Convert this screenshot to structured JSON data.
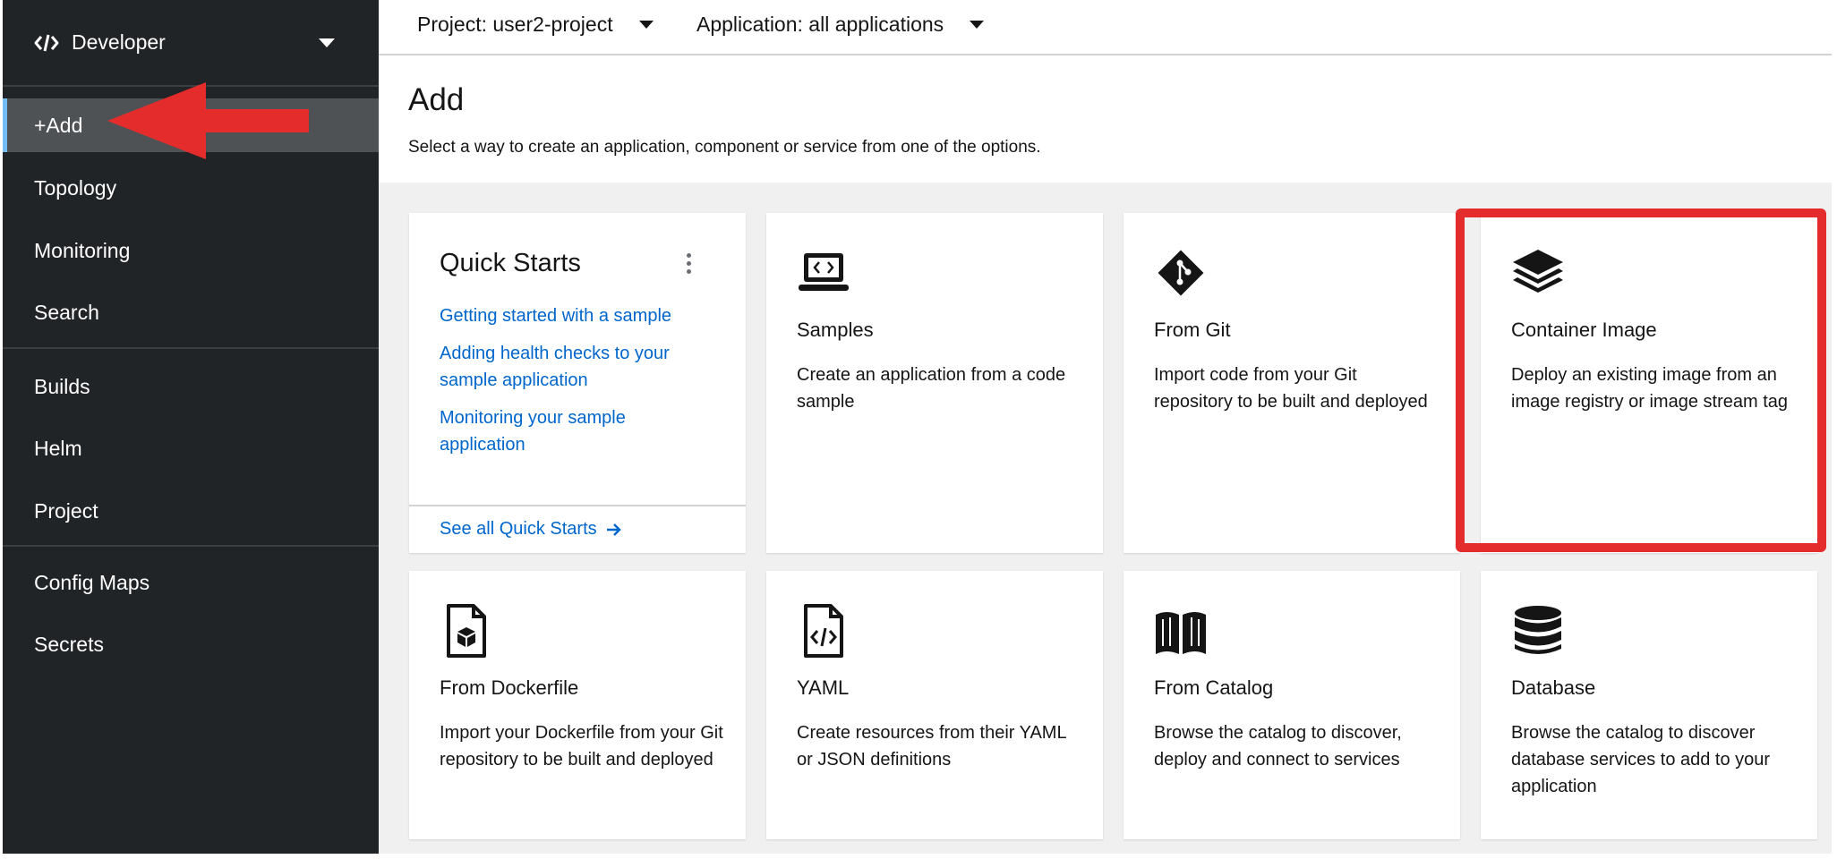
{
  "sidebar": {
    "perspective": "Developer",
    "items": [
      {
        "label": "+Add"
      },
      {
        "label": "Topology"
      },
      {
        "label": "Monitoring"
      },
      {
        "label": "Search"
      },
      {
        "label": "Builds"
      },
      {
        "label": "Helm"
      },
      {
        "label": "Project"
      },
      {
        "label": "Config Maps"
      },
      {
        "label": "Secrets"
      }
    ]
  },
  "topbar": {
    "project": "Project: user2-project",
    "application": "Application: all applications"
  },
  "page": {
    "title": "Add",
    "description": "Select a way to create an application, component or service from one of the options."
  },
  "quick_starts": {
    "title": "Quick Starts",
    "links": [
      "Getting started with a sample",
      "Adding health checks to your sample application",
      "Monitoring your sample application"
    ],
    "see_all": "See all Quick Starts"
  },
  "cards": [
    {
      "title": "Samples",
      "description": "Create an application from a code sample",
      "icon": "laptop-code-icon"
    },
    {
      "title": "From Git",
      "description": "Import code from your Git repository to be built and deployed",
      "icon": "git-icon"
    },
    {
      "title": "Container Image",
      "description": "Deploy an existing image from an image registry or image stream tag",
      "icon": "layer-group-icon"
    },
    {
      "title": "From Dockerfile",
      "description": "Import your Dockerfile from your Git repository to be built and deployed",
      "icon": "dockerfile-icon"
    },
    {
      "title": "YAML",
      "description": "Create resources from their YAML or JSON definitions",
      "icon": "file-code-icon"
    },
    {
      "title": "From Catalog",
      "description": "Browse the catalog to discover, deploy and connect to services",
      "icon": "book-open-icon"
    },
    {
      "title": "Database",
      "description": "Browse the catalog to discover database services to add to your application",
      "icon": "database-icon"
    }
  ],
  "colors": {
    "sidebar_bg": "#212427",
    "active_item_bg": "#4f5255",
    "active_indicator": "#73bcf7",
    "link": "#0066cc",
    "annotation_red": "#e42c2c"
  }
}
